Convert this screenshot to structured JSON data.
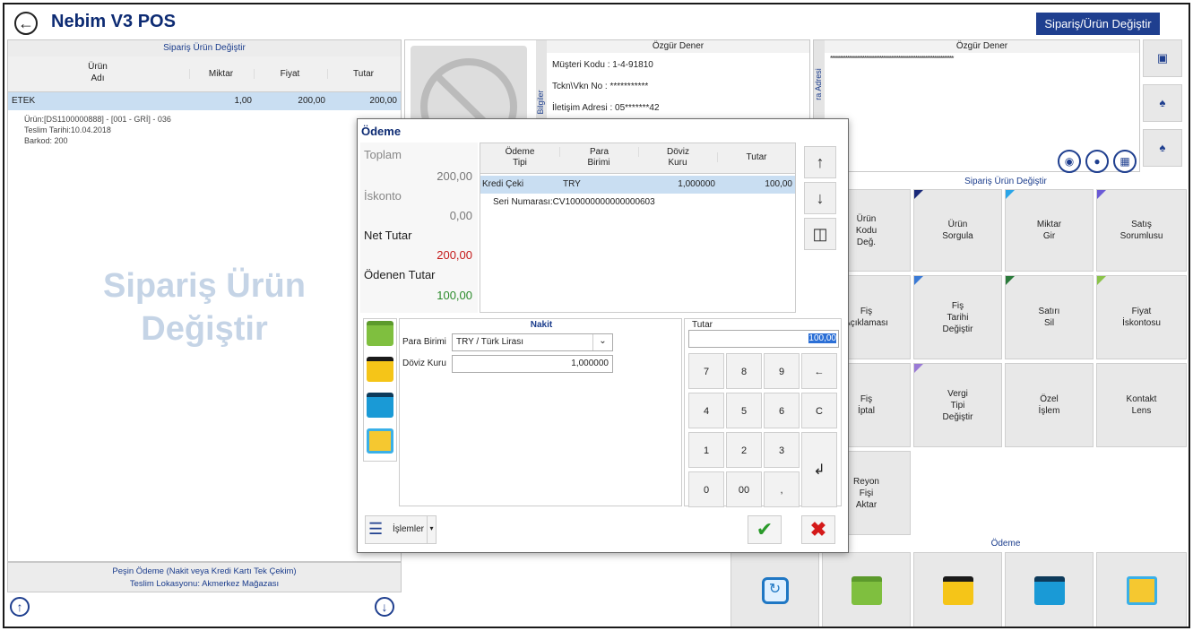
{
  "header": {
    "back_icon": "back-arrow-icon",
    "title": "Nebim V3 POS",
    "top_button": "Sipariş/Ürün Değiştir"
  },
  "left": {
    "panel_title": "Sipariş Ürün Değiştir",
    "columns": {
      "urun_line1": "Ürün",
      "urun_line2": "Adı",
      "miktar": "Miktar",
      "fiyat": "Fiyat",
      "tutar": "Tutar"
    },
    "row": {
      "name": "ETEK",
      "miktar": "1,00",
      "fiyat": "200,00",
      "tutar": "200,00"
    },
    "details": [
      "Ürün:[DS1100000888] - [001 - GRİ] - 036",
      "Teslim Tarihi:10.04.2018",
      "Barkod: 200"
    ],
    "watermark_line1": "Sipariş Ürün",
    "watermark_line2": "Değiştir",
    "footer_line1": "Peşin Ödeme (Nakit veya Kredi Kartı Tek Çekim)",
    "footer_line2": "Teslim Lokasyonu: Akmerkez Mağazası"
  },
  "customer": {
    "name": "Özgür Dener",
    "side_label": "Bilgiler",
    "kod": "Müşteri Kodu  :  1-4-91810",
    "tckn": "Tckn\\Vkn No  :  ***********",
    "iletisim": "İletişim Adresi : 05*******42"
  },
  "right_customer": {
    "name": "Özgür Dener",
    "stars": "*****************************************************************",
    "side_label": "ra Adresi"
  },
  "right_grid": {
    "title": "Sipariş Ürün Değiştir",
    "tiles": [
      "Ürün\nKodu\nDeğ.",
      "Ürün\nSorgula",
      "Miktar\nGir",
      "Satış\nSorumlusu",
      "Fiş\nAçıklaması",
      "Fiş\nTarihi\nDeğiştir",
      "Satırı\nSil",
      "Fiyat\nİskontosu",
      "Fiş\nİptal",
      "Vergi\nTipi\nDeğiştir",
      "Özel\nİşlem",
      "Kontakt\nLens",
      "Reyon\nFişi\nAktar"
    ],
    "corner_colors": [
      "#1a2a7a",
      "#2aa5e8",
      "#6a5ad6",
      "#2a7a3a",
      "#3a7ad6",
      "#2a7a3a",
      "#8bc34a",
      "#9a7ad6"
    ],
    "payment_title": "Ödeme"
  },
  "dialog": {
    "title": "Ödeme",
    "toplam_label": "Toplam",
    "toplam_value": "200,00",
    "iskonto_label": "İskonto",
    "iskonto_value": "0,00",
    "net_label": "Net Tutar",
    "net_value": "200,00",
    "odenen_label": "Ödenen Tutar",
    "odenen_value": "100,00",
    "columns": {
      "c1a": "Ödeme",
      "c1b": "Tipi",
      "c2a": "Para",
      "c2b": "Birimi",
      "c3a": "Döviz",
      "c3b": "Kuru",
      "c4": "Tutar"
    },
    "row": {
      "tip": "Kredi Çeki",
      "birim": "TRY",
      "kur": "1,000000",
      "tutar": "100,00",
      "seri": "Seri Numarası:CV100000000000000603"
    },
    "nakit_title": "Nakit",
    "para_birimi_label": "Para Birimi",
    "para_birimi_value": "TRY / Türk Lirası",
    "doviz_kuru_label": "Döviz Kuru",
    "doviz_kuru_value": "1,000000",
    "tutar_title": "Tutar",
    "tutar_value": "100,00",
    "keys": [
      "7",
      "8",
      "9",
      "←",
      "4",
      "5",
      "6",
      "C",
      "1",
      "2",
      "3",
      "0",
      "00",
      ","
    ],
    "enter_key": "↲",
    "islemler": "İşlemler"
  }
}
